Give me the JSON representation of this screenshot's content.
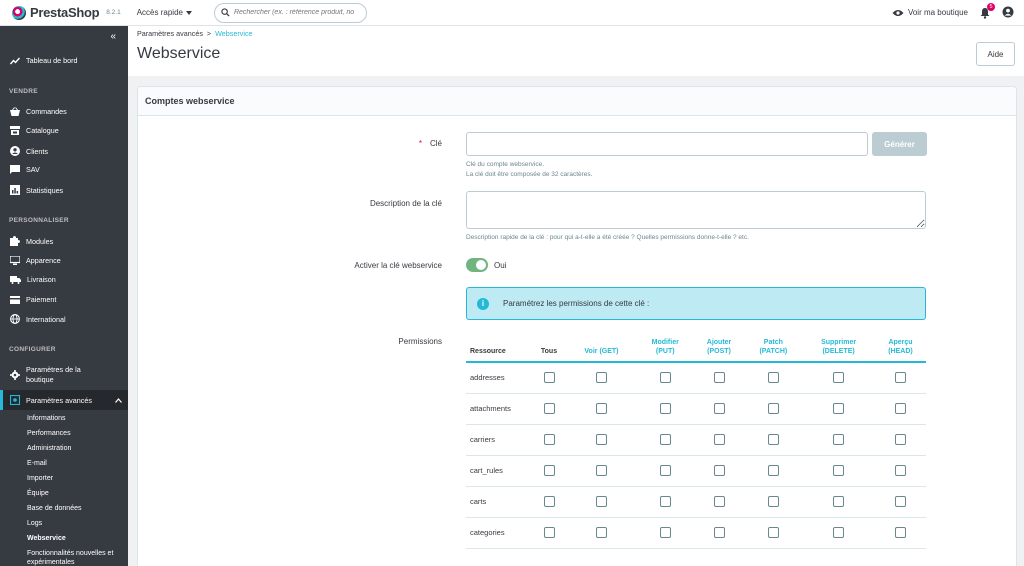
{
  "topbar": {
    "brand": "PrestaShop",
    "version": "8.2.1",
    "quick_access": "Accès rapide",
    "search_placeholder": "Rechercher (ex. : référence produit, no",
    "view_shop": "Voir ma boutique",
    "notifications_count": "5"
  },
  "sidebar": {
    "dashboard": "Tableau de bord",
    "sections": [
      {
        "title": "VENDRE",
        "items": [
          "Commandes",
          "Catalogue",
          "Clients",
          "SAV",
          "Statistiques"
        ]
      },
      {
        "title": "PERSONNALISER",
        "items": [
          "Modules",
          "Apparence",
          "Livraison",
          "Paiement",
          "International"
        ]
      },
      {
        "title": "CONFIGURER",
        "items": [
          "Paramètres de la boutique",
          "Paramètres avancés"
        ]
      }
    ],
    "shop_params_line1": "Paramètres de la",
    "shop_params_line2": "boutique",
    "advanced_sub": [
      "Informations",
      "Performances",
      "Administration",
      "E-mail",
      "Importer",
      "Équipe",
      "Base de données",
      "Logs",
      "Webservice"
    ],
    "new_features_line1": "Fonctionnalités nouvelles et",
    "new_features_line2": "expérimentales"
  },
  "header": {
    "breadcrumb_parent": "Paramètres avancés",
    "breadcrumb_sep": ">",
    "breadcrumb_current": "Webservice",
    "title": "Webservice",
    "help_button": "Aide"
  },
  "form": {
    "panel_title": "Comptes webservice",
    "key_label": "Clé",
    "required_mark": "*",
    "key_value": "",
    "generate_button": "Générer",
    "key_help_1": "Clé du compte webservice.",
    "key_help_2": "La clé doit être composée de 32 caractères.",
    "description_label": "Description de la clé",
    "description_value": "",
    "description_help": "Description rapide de la clé : pour qui a-t-elle a été créée ? Quelles permissions donne-t-elle ? etc.",
    "enable_label": "Activer la clé webservice",
    "enable_value": "Oui",
    "alert": "Paramétrez les permissions de cette clé :",
    "permissions_label": "Permissions"
  },
  "permissions": {
    "col_resource": "Ressource",
    "col_all": "Tous",
    "columns": [
      {
        "l1": "",
        "l2": "Voir (GET)"
      },
      {
        "l1": "Modifier",
        "l2": "(PUT)"
      },
      {
        "l1": "Ajouter",
        "l2": "(POST)"
      },
      {
        "l1": "Patch",
        "l2": "(PATCH)"
      },
      {
        "l1": "Supprimer",
        "l2": "(DELETE)"
      },
      {
        "l1": "Aperçu",
        "l2": "(HEAD)"
      }
    ],
    "rows": [
      "addresses",
      "attachments",
      "carriers",
      "cart_rules",
      "carts",
      "categories"
    ]
  },
  "colors": {
    "accent": "#25b9d7",
    "sidebar_bg": "#363a41",
    "toggle_on": "#70b580",
    "badge": "#df0067"
  }
}
